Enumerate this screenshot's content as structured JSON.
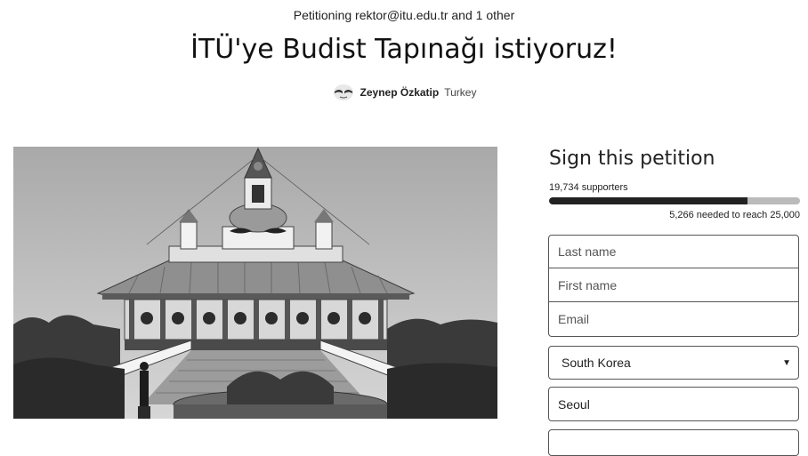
{
  "header": {
    "petitioning": "Petitioning rektor@itu.edu.tr and 1 other",
    "title": "İTÜ'ye Budist Tapınağı istiyoruz!",
    "author_name": "Zeynep Özkatip",
    "author_country": "Turkey"
  },
  "sign": {
    "heading": "Sign this petition",
    "supporters": "19,734 supporters",
    "progress_fraction": 0.79,
    "needed": "5,266 needed to reach 25,000",
    "last_name_placeholder": "Last name",
    "first_name_placeholder": "First name",
    "email_placeholder": "Email",
    "country_selected": "South Korea",
    "city_value": "Seoul"
  },
  "icons": {
    "avatar": "user-avatar",
    "dropdown": "chevron-down-icon"
  },
  "colors": {
    "progress_fill": "#222222",
    "progress_track": "#bbbbbb"
  }
}
